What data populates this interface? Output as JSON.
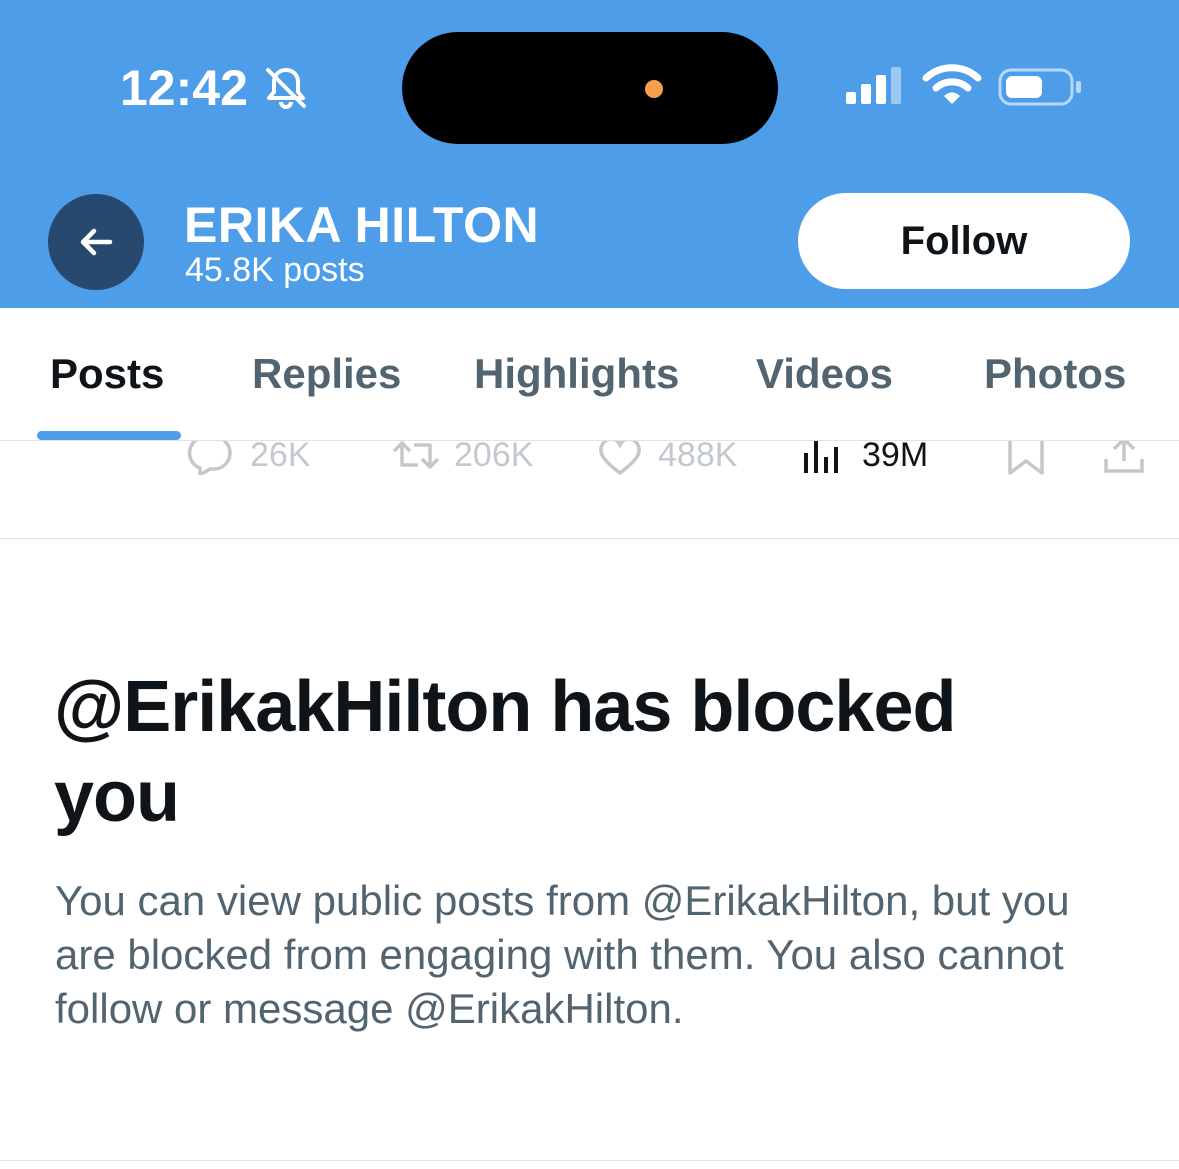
{
  "status_bar": {
    "time": "12:42",
    "icons": [
      "bell-slash-icon",
      "cellular-signal-icon",
      "wifi-icon",
      "battery-icon"
    ]
  },
  "header": {
    "title": "ERIKA HILTON",
    "subtitle": "45.8K posts",
    "follow_label": "Follow",
    "back_icon": "arrow-left-icon"
  },
  "tabs": [
    {
      "label": "Posts",
      "active": true
    },
    {
      "label": "Replies",
      "active": false
    },
    {
      "label": "Highlights",
      "active": false
    },
    {
      "label": "Videos",
      "active": false
    },
    {
      "label": "Photos",
      "active": false
    }
  ],
  "post_actions": {
    "replies": "26K",
    "reposts": "206K",
    "likes": "488K",
    "views": "39M"
  },
  "blocked_notice": {
    "title": "@ErikakHilton has blocked you",
    "body": "You can view public posts from @ErikakHilton, but you are blocked from engaging with them. You also cannot follow or message @ErikakHilton."
  },
  "colors": {
    "header_bg": "#4d9de8",
    "back_button_bg": "#27496f",
    "text_primary": "#0f1419",
    "text_secondary": "#536471",
    "island_dot": "#f5a04a"
  }
}
